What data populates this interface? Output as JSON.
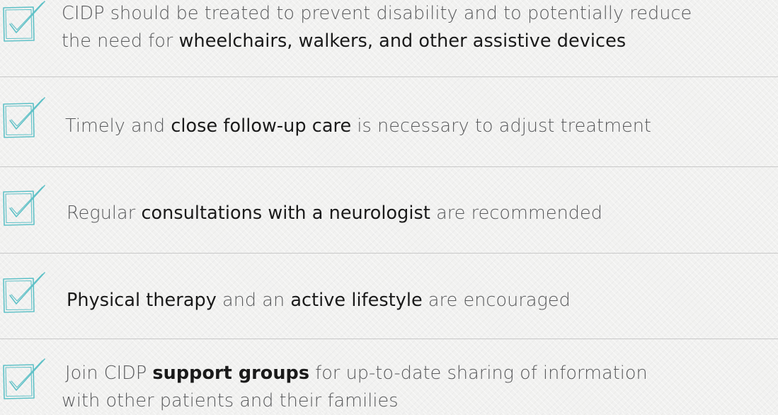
{
  "colors": {
    "body_text": "#58595b",
    "emphasis_text": "#1a1a1a",
    "checkbox": "#5fc1c7",
    "divider": "#c8c8c8"
  },
  "items": [
    {
      "icon": "checkbox-checked-icon",
      "segments": [
        {
          "text": "CIDP should be treated to prevent disability and to potentially reduce",
          "style": "normal"
        },
        {
          "text": "the need for ",
          "style": "normal"
        },
        {
          "text": "wheelchairs, walkers, and other assistive devices",
          "style": "highlight"
        }
      ]
    },
    {
      "icon": "checkbox-checked-icon",
      "segments": [
        {
          "text": "Timely and ",
          "style": "normal"
        },
        {
          "text": "close follow-up care",
          "style": "highlight"
        },
        {
          "text": " is necessary to adjust treatment",
          "style": "normal"
        }
      ]
    },
    {
      "icon": "checkbox-checked-icon",
      "segments": [
        {
          "text": "Regular ",
          "style": "normal"
        },
        {
          "text": "consultations with a neurologist",
          "style": "highlight"
        },
        {
          "text": " are recommended",
          "style": "normal"
        }
      ]
    },
    {
      "icon": "checkbox-checked-icon",
      "segments": [
        {
          "text": "Physical therapy",
          "style": "highlight"
        },
        {
          "text": " and an ",
          "style": "normal"
        },
        {
          "text": "active lifestyle",
          "style": "highlight"
        },
        {
          "text": " are encouraged",
          "style": "normal"
        }
      ]
    },
    {
      "icon": "checkbox-checked-icon",
      "segments": [
        {
          "text": "Join CIDP ",
          "style": "normal"
        },
        {
          "text": "support groups",
          "style": "bold"
        },
        {
          "text": " for up-to-date sharing of information",
          "style": "normal"
        },
        {
          "text": "with other patients and their families",
          "style": "normal"
        }
      ]
    }
  ]
}
